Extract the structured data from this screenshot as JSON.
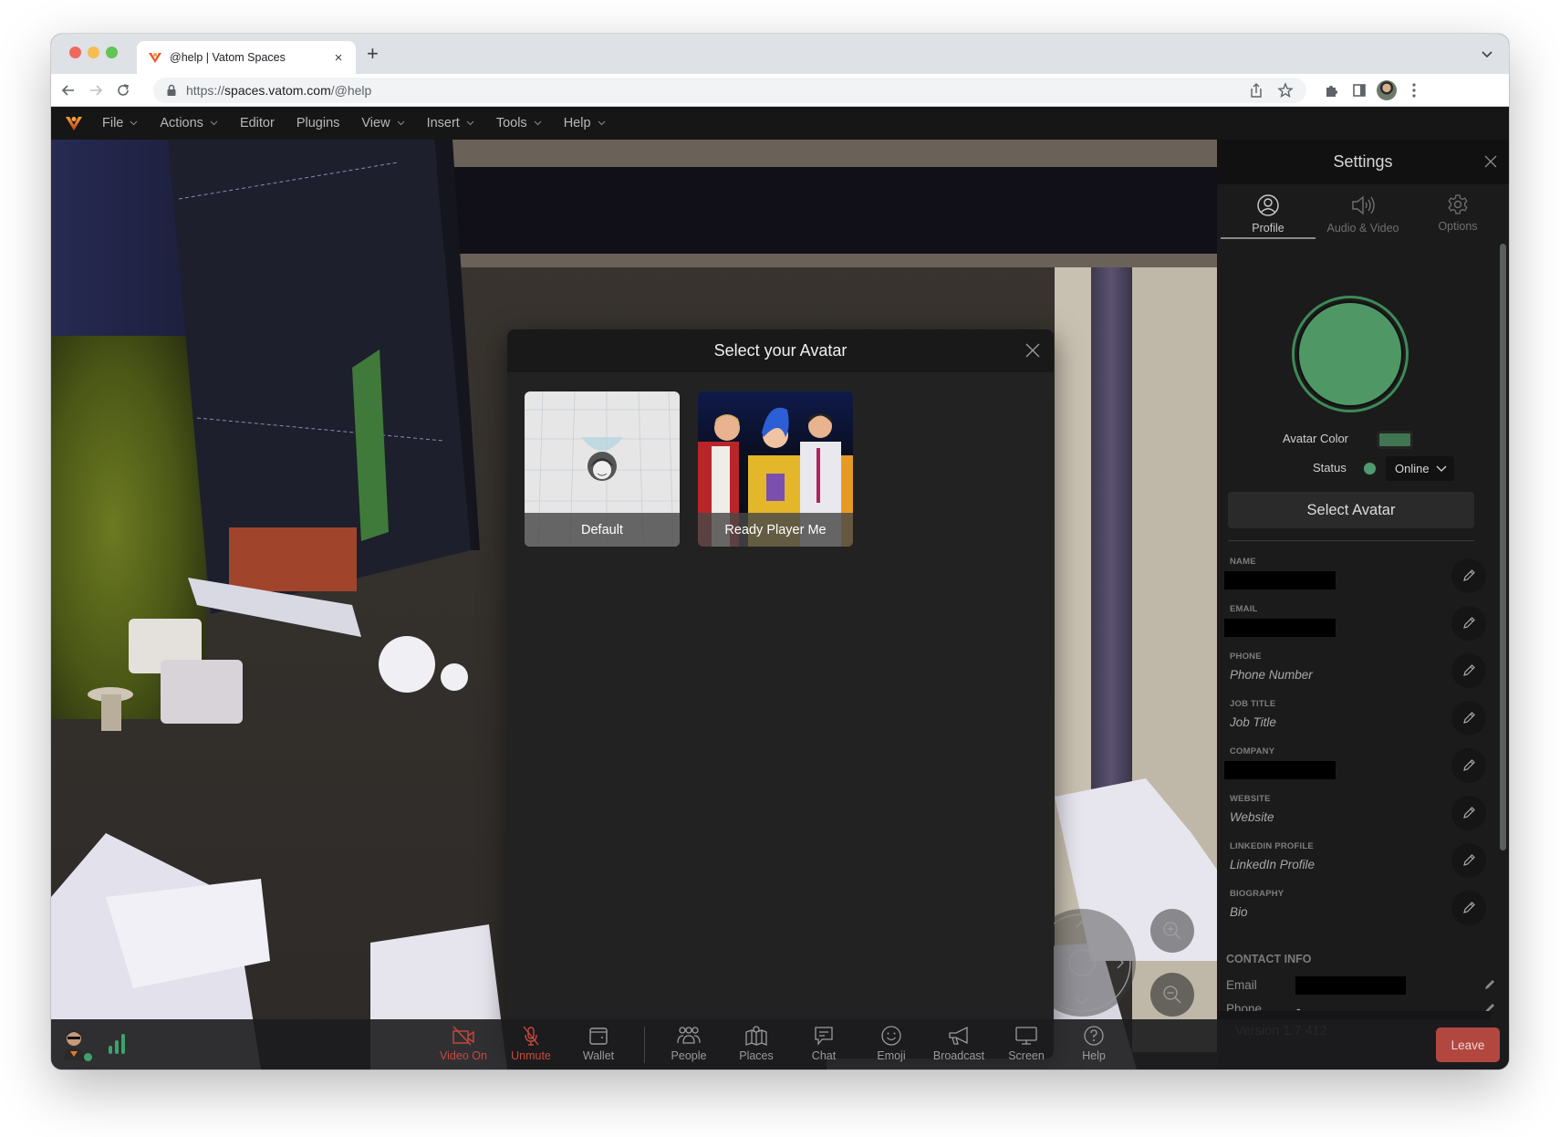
{
  "browser": {
    "tab_title": "@help | Vatom Spaces",
    "url_prefix": "https://",
    "url_domain": "spaces.vatom.com",
    "url_path": "/@help",
    "new_tab_label": "+",
    "tab_close_label": "×"
  },
  "menubar": {
    "items": [
      {
        "label": "File",
        "has_dropdown": true
      },
      {
        "label": "Actions",
        "has_dropdown": true
      },
      {
        "label": "Editor",
        "has_dropdown": false
      },
      {
        "label": "Plugins",
        "has_dropdown": false
      },
      {
        "label": "View",
        "has_dropdown": true
      },
      {
        "label": "Insert",
        "has_dropdown": true
      },
      {
        "label": "Tools",
        "has_dropdown": true
      },
      {
        "label": "Help",
        "has_dropdown": true
      }
    ]
  },
  "avatar_modal": {
    "title": "Select your Avatar",
    "options": [
      {
        "label": "Default",
        "icon": "default-avatar-thumbnail"
      },
      {
        "label": "Ready Player Me",
        "icon": "ready-player-me-thumbnail"
      }
    ]
  },
  "settings": {
    "title": "Settings",
    "tabs": [
      {
        "label": "Profile",
        "icon": "user-circle-icon",
        "active": true
      },
      {
        "label": "Audio & Video",
        "icon": "speaker-icon",
        "active": false
      },
      {
        "label": "Options",
        "icon": "gear-icon",
        "active": false
      }
    ],
    "avatar_color_label": "Avatar Color",
    "avatar_color": "#3f7550",
    "avatar_preview_color": "#4f9866",
    "status_label": "Status",
    "status_value": "Online",
    "status_color": "#4f9a6e",
    "select_avatar_label": "Select Avatar",
    "fields": [
      {
        "label": "NAME",
        "value": "",
        "redacted": true
      },
      {
        "label": "EMAIL",
        "value": "",
        "redacted": true
      },
      {
        "label": "PHONE",
        "value": "Phone Number",
        "redacted": false
      },
      {
        "label": "JOB TITLE",
        "value": "Job Title",
        "redacted": false
      },
      {
        "label": "COMPANY",
        "value": "",
        "redacted": true
      },
      {
        "label": "WEBSITE",
        "value": "Website",
        "redacted": false
      },
      {
        "label": "LINKEDIN PROFILE",
        "value": "LinkedIn Profile",
        "redacted": false
      },
      {
        "label": "BIOGRAPHY",
        "value": "Bio",
        "redacted": false
      }
    ],
    "contact_info_title": "CONTACT INFO",
    "contact_rows": [
      {
        "label": "Email",
        "value": "",
        "redacted": true
      },
      {
        "label": "Phone",
        "value": "-",
        "redacted": false
      }
    ],
    "version": "Version 1.7.412"
  },
  "bottombar": {
    "items": [
      {
        "label": "Video On",
        "icon": "video-off-icon",
        "state": "danger"
      },
      {
        "label": "Unmute",
        "icon": "mic-off-icon",
        "state": "danger"
      },
      {
        "label": "Wallet",
        "icon": "wallet-icon",
        "state": "normal"
      },
      {
        "label": "People",
        "icon": "people-icon",
        "state": "normal"
      },
      {
        "label": "Places",
        "icon": "map-icon",
        "state": "normal"
      },
      {
        "label": "Chat",
        "icon": "chat-icon",
        "state": "normal"
      },
      {
        "label": "Emoji",
        "icon": "emoji-icon",
        "state": "normal"
      },
      {
        "label": "Broadcast",
        "icon": "megaphone-icon",
        "state": "normal"
      },
      {
        "label": "Screen",
        "icon": "monitor-icon",
        "state": "normal"
      },
      {
        "label": "Help",
        "icon": "help-icon",
        "state": "normal"
      }
    ],
    "leave_label": "Leave",
    "danger_color": "#c9493d",
    "leave_color": "#b2473f"
  }
}
